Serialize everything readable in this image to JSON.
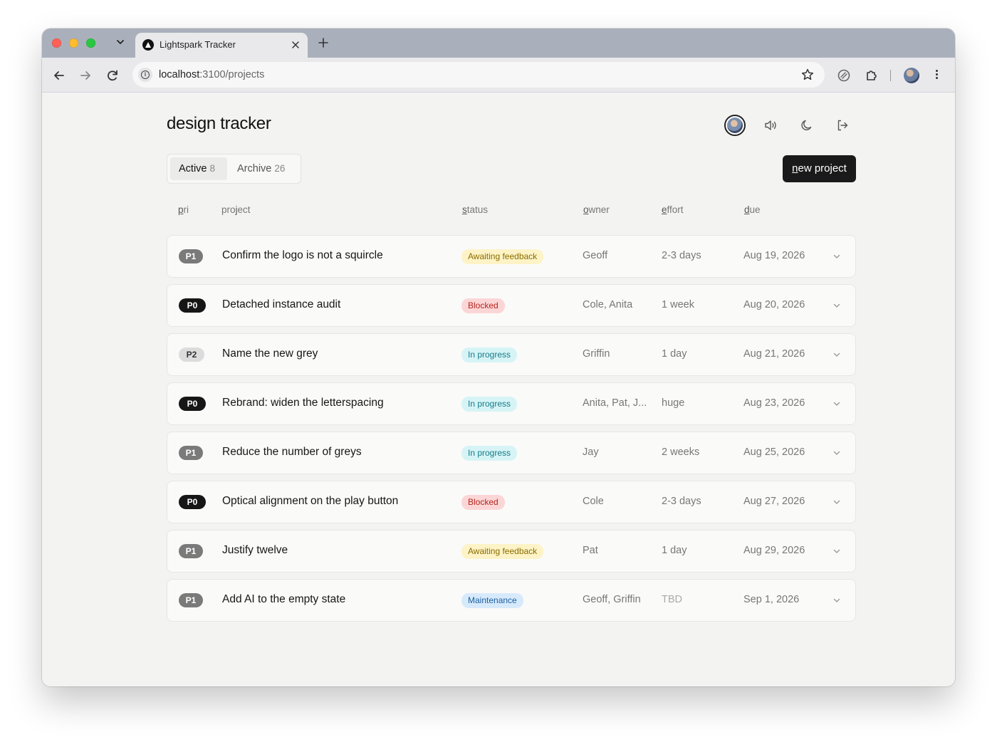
{
  "browser": {
    "tab_title": "Lightspark Tracker",
    "url_host": "localhost",
    "url_path": ":3100/projects"
  },
  "app": {
    "title": "design tracker",
    "new_button_underlined": "n",
    "new_button_rest": "ew project",
    "tabs": [
      {
        "label": "Active",
        "count": "8"
      },
      {
        "label": "Archive",
        "count": "26"
      }
    ],
    "columns": {
      "pri_u": "p",
      "pri_rest": "ri",
      "project_a": "pro",
      "project_u": "j",
      "project_b": "ect",
      "status_u": "s",
      "status_rest": "tatus",
      "owner_u": "o",
      "owner_rest": "wner",
      "effort_u": "e",
      "effort_rest": "ffort",
      "due_u": "d",
      "due_rest": "ue"
    }
  },
  "rows": [
    {
      "pri": "P1",
      "project": "Confirm the logo is not a squircle",
      "status": "Awaiting feedback",
      "owner": "Geoff",
      "effort": "2-3 days",
      "due": "Aug 19, 2026"
    },
    {
      "pri": "P0",
      "project": "Detached instance audit",
      "status": "Blocked",
      "owner": "Cole, Anita",
      "effort": "1 week",
      "due": "Aug 20, 2026"
    },
    {
      "pri": "P2",
      "project": "Name the new grey",
      "status": "In progress",
      "owner": "Griffin",
      "effort": "1 day",
      "due": "Aug 21, 2026"
    },
    {
      "pri": "P0",
      "project": "Rebrand: widen the letterspacing",
      "status": "In progress",
      "owner": "Anita, Pat, J...",
      "effort": "huge",
      "due": "Aug 23, 2026"
    },
    {
      "pri": "P1",
      "project": "Reduce the number of greys",
      "status": "In progress",
      "owner": "Jay",
      "effort": "2 weeks",
      "due": "Aug 25, 2026"
    },
    {
      "pri": "P0",
      "project": "Optical alignment on the play button",
      "status": "Blocked",
      "owner": "Cole",
      "effort": "2-3 days",
      "due": "Aug 27, 2026"
    },
    {
      "pri": "P1",
      "project": "Justify twelve",
      "status": "Awaiting feedback",
      "owner": "Pat",
      "effort": "1 day",
      "due": "Aug 29, 2026"
    },
    {
      "pri": "P1",
      "project": "Add AI to the empty state",
      "status": "Maintenance",
      "owner": "Geoff, Griffin",
      "effort": "TBD",
      "due": "Sep 1, 2026"
    }
  ],
  "status_colors": {
    "Awaiting feedback": "#fdf3c6",
    "Blocked": "#fcd6d6",
    "In progress": "#d6f4f6",
    "Maintenance": "#d7eafc"
  },
  "icons": [
    "back-arrow-icon",
    "forward-arrow-icon",
    "reload-icon",
    "info-icon",
    "star-icon",
    "extension-icon",
    "puzzle-icon",
    "kebab-menu-icon",
    "speaker-icon",
    "moon-icon",
    "logout-icon",
    "chevron-down-icon"
  ]
}
